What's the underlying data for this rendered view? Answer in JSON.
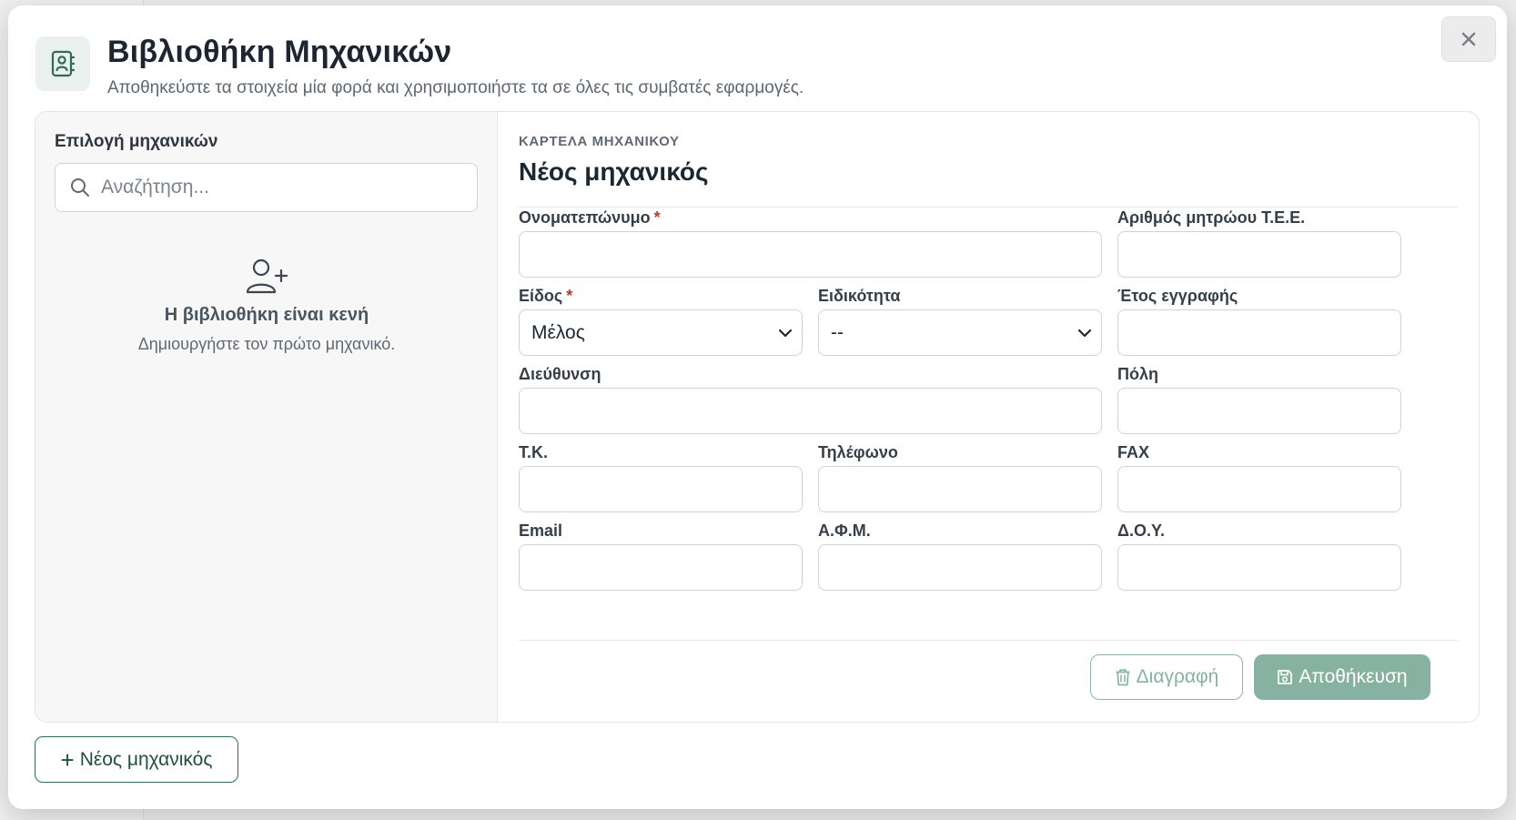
{
  "modal": {
    "title": "Βιβλιοθήκη Μηχανικών",
    "subtitle": "Αποθηκεύστε τα στοιχεία μία φορά και χρησιμοποιήστε τα σε όλες τις συμβατές εφαρμογές.",
    "header_icon": "address-book-icon",
    "close_icon": "close-icon"
  },
  "left": {
    "heading": "Επιλογή μηχανικών",
    "search_placeholder": "Αναζήτηση...",
    "search_icon": "search-icon",
    "empty_icon": "add-user-icon",
    "empty_title": "Η βιβλιοθήκη είναι κενή",
    "empty_subtitle": "Δημιουργήστε τον πρώτο μηχανικό."
  },
  "card": {
    "kicker": "ΚΑΡΤΕΛΑ ΜΗΧΑΝΙΚΟΥ",
    "title": "Νέος μηχανικός"
  },
  "form": {
    "full_name": {
      "label": "Ονοματεπώνυμο",
      "required": "*",
      "value": ""
    },
    "tee_number": {
      "label": "Αριθμός μητρώου Τ.Ε.Ε.",
      "value": ""
    },
    "type": {
      "label": "Είδος",
      "required": "*",
      "value": "Μέλος"
    },
    "specialty": {
      "label": "Ειδικότητα",
      "value": "--"
    },
    "registration_year": {
      "label": "Έτος εγγραφής",
      "value": ""
    },
    "address": {
      "label": "Διεύθυνση",
      "value": ""
    },
    "city": {
      "label": "Πόλη",
      "value": ""
    },
    "postal_code": {
      "label": "Τ.Κ.",
      "value": ""
    },
    "phone": {
      "label": "Τηλέφωνο",
      "value": ""
    },
    "fax": {
      "label": "FAX",
      "value": ""
    },
    "email": {
      "label": "Email",
      "value": ""
    },
    "afm": {
      "label": "Α.Φ.Μ.",
      "value": ""
    },
    "doy": {
      "label": "Δ.Ο.Υ.",
      "value": ""
    }
  },
  "actions": {
    "delete_label": "Διαγραφή",
    "save_label": "Αποθήκευση",
    "new_label": "Νέος μηχανικός",
    "delete_icon": "trash-icon",
    "save_icon": "floppy-disk-icon",
    "new_icon": "plus-icon"
  },
  "colors": {
    "accent": "#234e3f",
    "accent_muted": "#87b2a1",
    "required": "#c0392b"
  }
}
